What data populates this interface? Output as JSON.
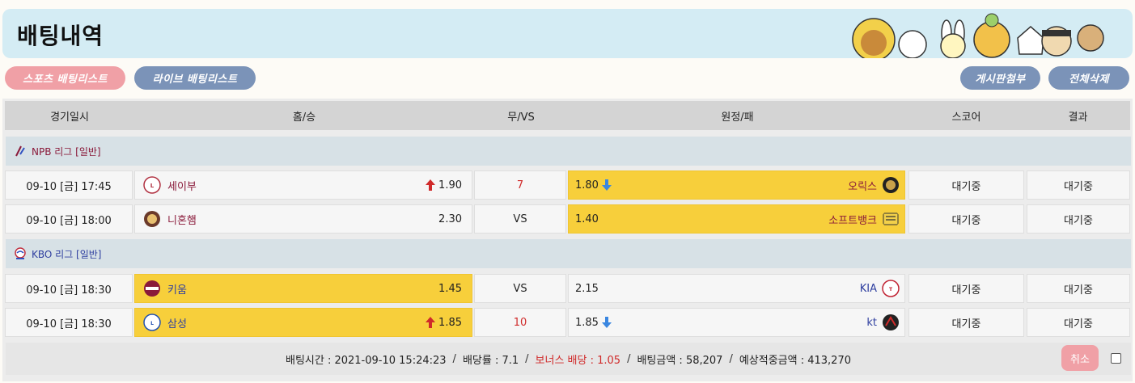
{
  "header": {
    "title": "배팅내역"
  },
  "buttons": {
    "sports_list": "스포츠 배팅리스트",
    "live_list": "라이브 배팅리스트",
    "attach_board": "게시판첨부",
    "delete_all": "전체삭제"
  },
  "columns": [
    "경기일시",
    "홈/승",
    "무/VS",
    "원정/패",
    "스코어",
    "결과"
  ],
  "leagues": [
    {
      "name": "NPB 리그 [일반]",
      "games": [
        {
          "datetime": "09-10 [금] 17:45",
          "home": "세이부",
          "home_odds": "1.90",
          "home_arrow": "up",
          "draw": "7",
          "away_odds": "1.80",
          "away_arrow": "down",
          "away": "오릭스",
          "score": "대기중",
          "result": "대기중",
          "selected": "away"
        },
        {
          "datetime": "09-10 [금] 18:00",
          "home": "니혼햄",
          "home_odds": "2.30",
          "home_arrow": "",
          "draw": "VS",
          "away_odds": "1.40",
          "away_arrow": "",
          "away": "소프트뱅크",
          "score": "대기중",
          "result": "대기중",
          "selected": "away"
        }
      ]
    },
    {
      "name": "KBO 리그 [일반]",
      "games": [
        {
          "datetime": "09-10 [금] 18:30",
          "home": "키움",
          "home_odds": "1.45",
          "home_arrow": "",
          "draw": "VS",
          "away_odds": "2.15",
          "away_arrow": "",
          "away": "KIA",
          "score": "대기중",
          "result": "대기중",
          "selected": "home"
        },
        {
          "datetime": "09-10 [금] 18:30",
          "home": "삼성",
          "home_odds": "1.85",
          "home_arrow": "up",
          "draw": "10",
          "away_odds": "1.85",
          "away_arrow": "down",
          "away": "kt",
          "score": "대기중",
          "result": "대기중",
          "selected": "home"
        }
      ]
    }
  ],
  "footer": {
    "bet_time": "배팅시간 : 2021-09-10 15:24:23",
    "odds_rate": "배당률 : 7.1",
    "bonus": "보너스 배당 : 1.05",
    "bet_amount": "배팅금액 : 58,207",
    "expected": "예상적중금액 : 413,270",
    "cancel_label": "취소"
  },
  "colors": {
    "header_bg": "#d4ecf4",
    "pink": "#f0a0a6",
    "blue": "#7b93b8",
    "selected": "#f7cf3b",
    "up_arrow": "#d02a2a",
    "down_arrow": "#3a86e0"
  },
  "icons": [
    "up-arrow-icon",
    "down-arrow-icon",
    "npb-logo-icon",
    "kbo-logo-icon"
  ]
}
